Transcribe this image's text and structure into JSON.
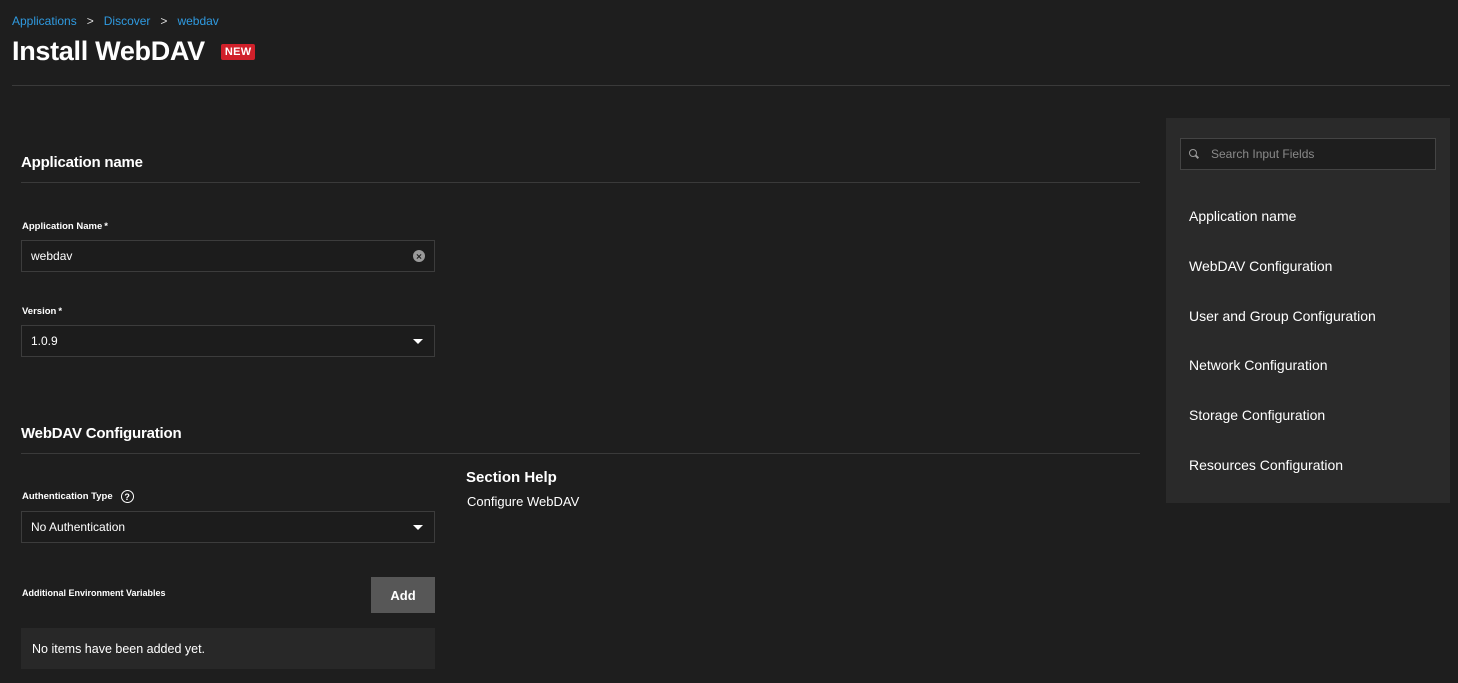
{
  "breadcrumb": {
    "items": [
      "Applications",
      "Discover",
      "webdav"
    ],
    "separator": ">"
  },
  "header": {
    "title": "Install WebDAV",
    "badge": "NEW"
  },
  "sections": {
    "app_name": {
      "title": "Application name",
      "name_label": "Application Name",
      "name_value": "webdav",
      "version_label": "Version",
      "version_value": "1.0.9",
      "required_mark": "*"
    },
    "webdav": {
      "title": "WebDAV Configuration",
      "auth_label": "Authentication Type",
      "auth_value": "No Authentication",
      "env_label": "Additional Environment Variables",
      "add_label": "Add",
      "empty_text": "No items have been added yet."
    }
  },
  "help": {
    "title": "Section Help",
    "text": "Configure WebDAV"
  },
  "side_panel": {
    "search_placeholder": "Search Input Fields",
    "nav": [
      "Application name",
      "WebDAV Configuration",
      "User and Group Configuration",
      "Network Configuration",
      "Storage Configuration",
      "Resources Configuration"
    ]
  },
  "colors": {
    "background": "#1e1e1e",
    "link": "#2f9ae0",
    "badge": "#d0202a",
    "panel": "#2a2a2a",
    "button": "#575757"
  }
}
